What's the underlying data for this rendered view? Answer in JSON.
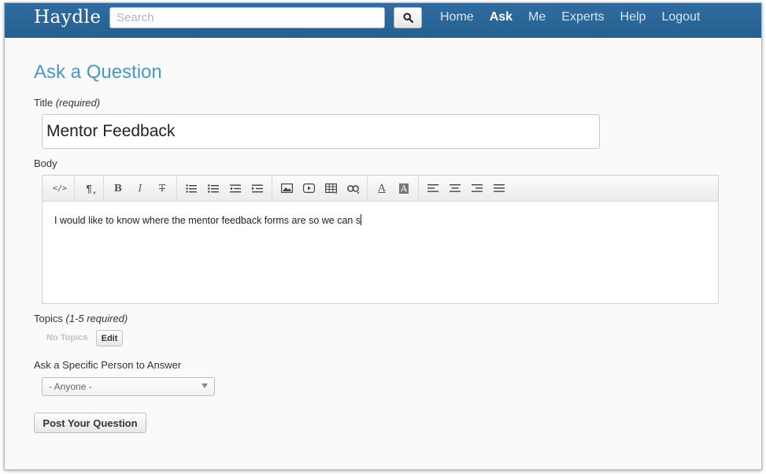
{
  "app": {
    "brand": "Haydle"
  },
  "search": {
    "placeholder": "Search"
  },
  "nav": {
    "links": [
      {
        "label": "Home"
      },
      {
        "label": "Ask"
      },
      {
        "label": "Me"
      },
      {
        "label": "Experts"
      },
      {
        "label": "Help"
      },
      {
        "label": "Logout"
      }
    ],
    "active": "Ask"
  },
  "form": {
    "heading": "Ask a Question",
    "title_label": "Title",
    "title_hint": "(required)",
    "title_value": "Mentor Feedback",
    "body_label": "Body",
    "body_text": "I would like to know where the mentor feedback forms are so we can s",
    "topics_label": "Topics",
    "topics_hint": "(1-5 required)",
    "no_topics": "No Topics",
    "edit_label": "Edit",
    "ask_person_label": "Ask a Specific Person to Answer",
    "ask_person_value": "- Anyone -",
    "submit_label": "Post Your Question"
  },
  "toolbar_icons": [
    "code-view-icon",
    "paragraph-icon",
    "bold-icon",
    "italic-icon",
    "strikethrough-icon",
    "bulleted-list-icon",
    "numbered-list-icon",
    "outdent-icon",
    "indent-icon",
    "image-icon",
    "video-icon",
    "table-icon",
    "link-icon",
    "font-color-icon",
    "background-color-icon",
    "align-left-icon",
    "align-center-icon",
    "align-right-icon",
    "justify-icon"
  ],
  "colors": {
    "navbar": "#2a6496",
    "heading": "#4a97c9"
  }
}
